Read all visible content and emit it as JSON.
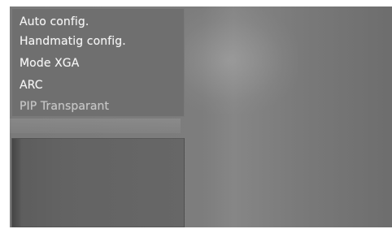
{
  "menu": {
    "items": [
      {
        "label": "Auto config.",
        "state": "normal"
      },
      {
        "label": "Handmatig config.",
        "state": "normal"
      },
      {
        "label": "Mode XGA",
        "state": "normal"
      },
      {
        "label": "ARC",
        "state": "normal"
      },
      {
        "label": "PIP Transparant",
        "state": "disabled"
      }
    ]
  }
}
